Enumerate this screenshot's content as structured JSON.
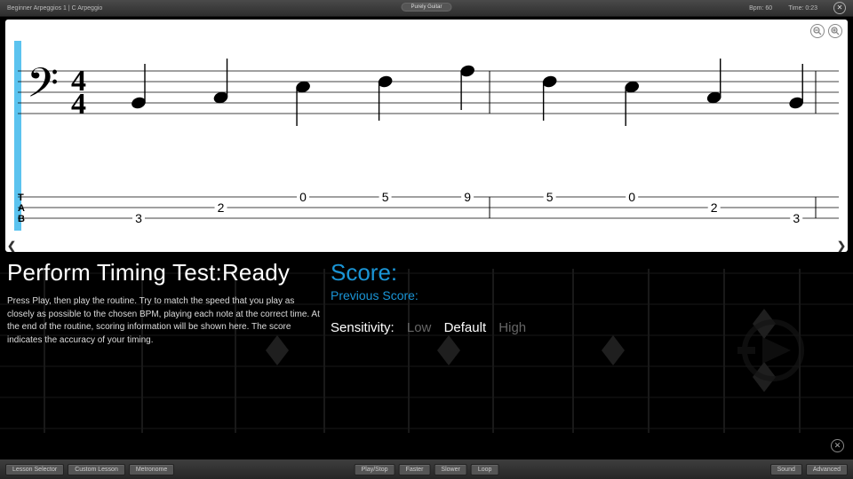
{
  "topbar": {
    "breadcrumb": "Beginner Arpeggios 1 | C Arpeggio",
    "brand": "Purely Guitar",
    "bpm_label": "Bpm: 60",
    "time_label": "Time: 0:23"
  },
  "chart_data": {
    "type": "table",
    "title": "Bass clef 4/4 notation with guitar tab",
    "clef": "bass",
    "time_signature": "4/4",
    "staff_notes": [
      {
        "step_from_top_line": 6,
        "stem": "up"
      },
      {
        "step_from_top_line": 5,
        "stem": "up"
      },
      {
        "step_from_top_line": 3,
        "stem": "down"
      },
      {
        "step_from_top_line": 2,
        "stem": "down"
      },
      {
        "step_from_top_line": 0,
        "stem": "down"
      },
      {
        "step_from_top_line": 2,
        "stem": "down"
      },
      {
        "step_from_top_line": 3,
        "stem": "down"
      },
      {
        "step_from_top_line": 5,
        "stem": "up"
      },
      {
        "step_from_top_line": 6,
        "stem": "up"
      }
    ],
    "tab_strings": [
      "T",
      "A",
      "B"
    ],
    "tab_frets": [
      {
        "string": 2,
        "fret": "3"
      },
      {
        "string": 1,
        "fret": "2"
      },
      {
        "string": 0,
        "fret": "0"
      },
      {
        "string": 0,
        "fret": "5"
      },
      {
        "string": 0,
        "fret": "9"
      },
      {
        "string": 0,
        "fret": "5"
      },
      {
        "string": 0,
        "fret": "0"
      },
      {
        "string": 1,
        "fret": "2"
      },
      {
        "string": 2,
        "fret": "3"
      }
    ],
    "bars": 2
  },
  "timing": {
    "heading_prefix": "Perform Timing Test:",
    "heading_status": "Ready",
    "instructions": "Press Play, then play the routine. Try to match the speed that you play as closely as possible to the chosen BPM, playing each note at the correct time. At the end of the routine, scoring information will be shown here. The score indicates the accuracy of your timing.",
    "score_label": "Score:",
    "prev_score_label": "Previous Score:",
    "sensitivity_label": "Sensitivity:",
    "sensitivity_options": [
      "Low",
      "Default",
      "High"
    ],
    "sensitivity_selected": "Default"
  },
  "buttons": {
    "lesson_selector": "Lesson Selector",
    "custom_lesson": "Custom Lesson",
    "metronome": "Metronome",
    "play_stop": "Play/Stop",
    "faster": "Faster",
    "slower": "Slower",
    "loop": "Loop",
    "sound": "Sound",
    "advanced": "Advanced"
  },
  "icons": {
    "close": "✕",
    "zoom_out": "−",
    "zoom_in": "+",
    "left": "❮",
    "right": "❯"
  }
}
